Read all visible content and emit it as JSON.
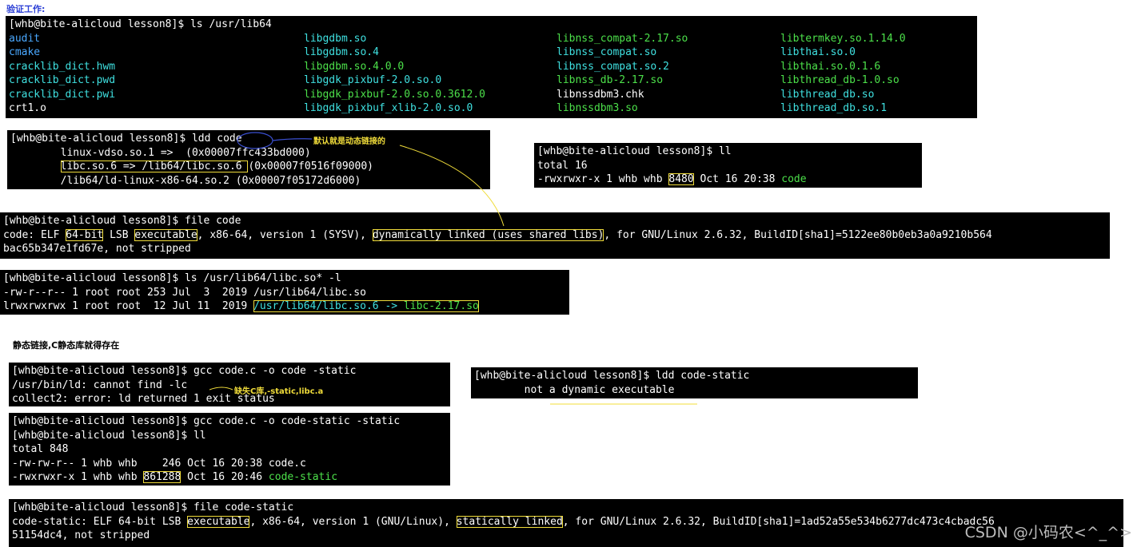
{
  "caption_top": "验证工作:",
  "term1": {
    "prompt": "[whb@bite-alicloud lesson8]$ ls /usr/lib64",
    "columns": [
      [
        "audit",
        "cmake",
        "cracklib_dict.hwm",
        "cracklib_dict.pwd",
        "cracklib_dict.pwi",
        "crt1.o"
      ],
      [
        "libgdbm.so",
        "libgdbm.so.4",
        "libgdbm.so.4.0.0",
        "libgdk_pixbuf-2.0.so.0",
        "libgdk_pixbuf-2.0.so.0.3612.0",
        "libgdk_pixbuf_xlib-2.0.so.0"
      ],
      [
        "libnss_compat-2.17.so",
        "libnss_compat.so",
        "libnss_compat.so.2",
        "libnss_db-2.17.so",
        "libnssdbm3.chk",
        "libnssdbm3.so"
      ],
      [
        "libtermkey.so.1.14.0",
        "libthai.so.0",
        "libthai.so.0.1.6",
        "libthread_db-1.0.so",
        "libthread_db.so",
        "libthread_db.so.1"
      ]
    ]
  },
  "term2": {
    "prompt": "[whb@bite-alicloud lesson8]$ ldd code",
    "line1": "        linux-vdso.so.1 =>  (0x00007ffc433bd000)",
    "line2_pre": "        ",
    "line2_hl": "libc.so.6 => /lib64/libc.so.6 ",
    "line2_post": "(0x00007f0516f09000)",
    "line3": "        /lib64/ld-linux-x86-64.so.2 (0x00007f05172d6000)",
    "note": "默认就是动态链接的"
  },
  "term3": {
    "prompt": "[whb@bite-alicloud lesson8]$ ll",
    "line1": "total 16",
    "line2_pre": "-rwxrwxr-x 1 whb whb ",
    "line2_hl": "8480",
    "line2_mid": " Oct 16 20:38 ",
    "line2_file": "code"
  },
  "term4": {
    "prompt": "[whb@bite-alicloud lesson8]$ file code",
    "l_a": "code: ELF ",
    "l_b": "64-bit",
    "l_c": " LSB ",
    "l_d": "executable",
    "l_e": ", x86-64, version 1 (SYSV), ",
    "l_f": "dynamically linked (uses shared libs)",
    "l_g": ", for GNU/Linux 2.6.32, BuildID[sha1]=5122ee80b0eb3a0a9210b564",
    "line2": "bac65b347e1fd67e, not stripped"
  },
  "term5": {
    "prompt": "[whb@bite-alicloud lesson8]$ ls /usr/lib64/libc.so* -l",
    "line1": "-rw-r--r-- 1 root root 253 Jul  3  2019 /usr/lib64/libc.so",
    "line2_pre": "lrwxrwxrwx 1 root root  12 Jul 11  2019 ",
    "line2_link": "/usr/lib64/libc.so.6 -> ",
    "line2_target": "libc-2.17.so"
  },
  "caption_static": "静态链接,C静态库就得存在",
  "term6": {
    "prompt": "[whb@bite-alicloud lesson8]$ gcc code.c -o code -static",
    "line1": "/usr/bin/ld: cannot find -lc",
    "line2": "collect2: error: ld returned 1 exit status",
    "note": "缺失C库,-static,libc.a"
  },
  "term7": {
    "prompt": "[whb@bite-alicloud lesson8]$ ldd code-static",
    "line1": "        not a dynamic executable"
  },
  "term8": {
    "prompt1": "[whb@bite-alicloud lesson8]$ gcc code.c -o code-static -static",
    "prompt2": "[whb@bite-alicloud lesson8]$ ll",
    "line1": "total 848",
    "line2": "-rw-rw-r-- 1 whb whb    246 Oct 16 20:38 code.c",
    "line3_pre": "-rwxrwxr-x 1 whb whb ",
    "line3_hl": "861288",
    "line3_mid": " Oct 16 20:46 ",
    "line3_file": "code-static"
  },
  "term9": {
    "prompt": "[whb@bite-alicloud lesson8]$ file code-static",
    "l_a": "code-static: ELF 64-bit LSB ",
    "l_b": "executable",
    "l_c": ", x86-64, version 1 (GNU/Linux), ",
    "l_d": "statically linked",
    "l_e": ", for GNU/Linux 2.6.32, BuildID[sha1]=1ad52a55e534b6277dc473c4cbadc56",
    "line2": "51154dc4, not stripped"
  },
  "watermark": "CSDN @小码农<^_^>",
  "colors": {
    "terminal_bg": "#000000",
    "highlight": "#f0dc3a",
    "exec_green": "#4ce04a",
    "dir_blue": "#4aa8ff",
    "link_cyan": "#3fe0e0"
  }
}
